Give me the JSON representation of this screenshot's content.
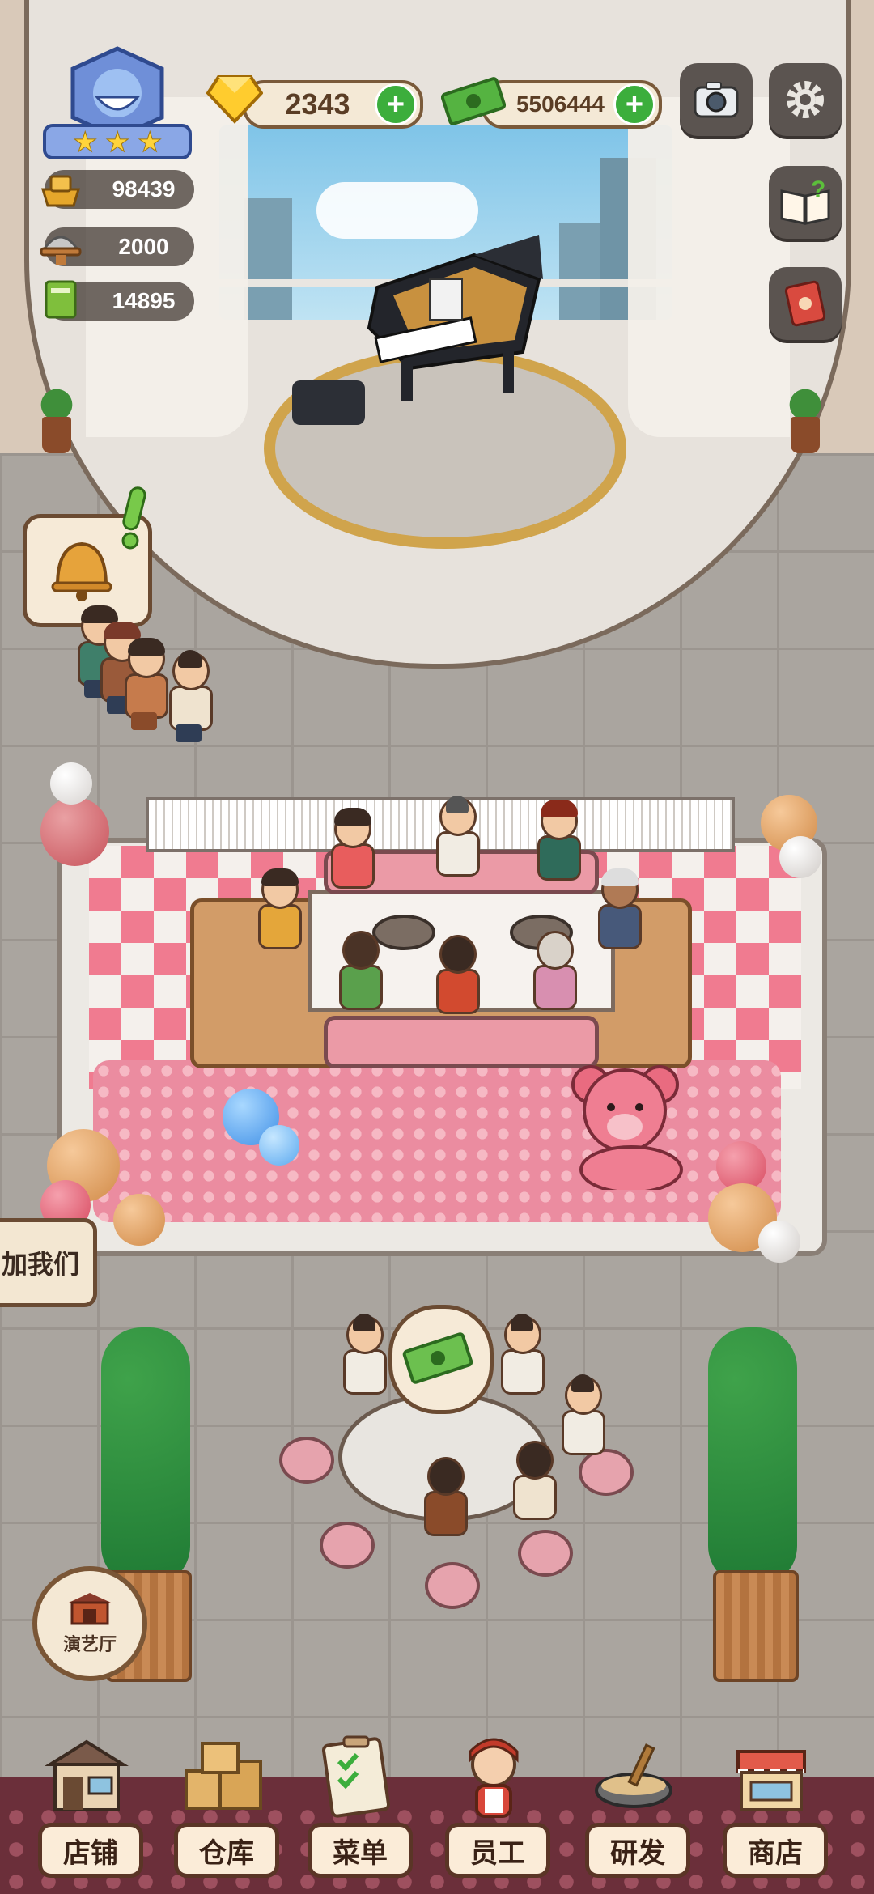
{
  "hud": {
    "diamonds": "2343",
    "cash": "5506444",
    "stats": [
      "98439",
      "2000",
      "14895"
    ],
    "restaurant_stars": 3
  },
  "right_buttons": [
    "camera-icon",
    "gear-icon",
    "help-book-icon",
    "recipe-book-icon"
  ],
  "left_bubble_icon": "bell-icon",
  "join_text": "加我们",
  "venue_button": "演艺厅",
  "nav": [
    "店铺",
    "仓库",
    "菜单",
    "员工",
    "研发",
    "商店"
  ],
  "colors": {
    "accent_green": "#3cae3c",
    "frame_brown": "#6b4b32",
    "nav_bar": "#6b2f3a"
  }
}
